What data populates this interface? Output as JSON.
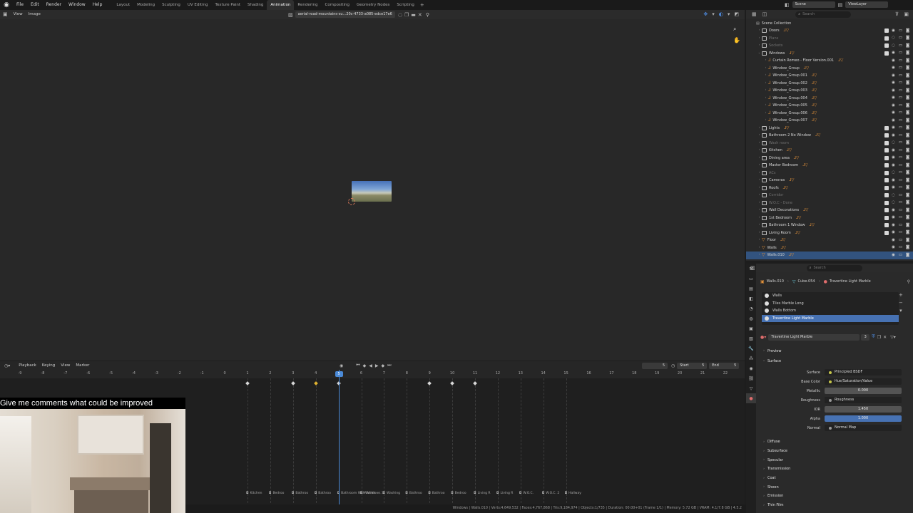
{
  "topbar": {
    "menus": [
      "File",
      "Edit",
      "Render",
      "Window",
      "Help"
    ],
    "workspaces": [
      "Layout",
      "Modeling",
      "Sculpting",
      "UV Editing",
      "Texture Paint",
      "Shading",
      "Animation",
      "Rendering",
      "Compositing",
      "Geometry Nodes",
      "Scripting"
    ],
    "active_workspace": "Animation",
    "scene_label": "Scene",
    "viewlayer_label": "ViewLayer"
  },
  "viewer": {
    "view_label": "View",
    "image_label": "Image",
    "image_name": "aerial-road-mountains-su...20c-4733-a085-edce17e6"
  },
  "outliner": {
    "search_placeholder": "Search",
    "scene_collection": "Scene Collection",
    "rows": [
      {
        "name": "Doors",
        "indent": 1,
        "type": "coll",
        "dim": false,
        "expanded": false
      },
      {
        "name": "Plans",
        "indent": 1,
        "type": "coll",
        "dim": true,
        "expanded": false
      },
      {
        "name": "Sockets",
        "indent": 1,
        "type": "coll",
        "dim": true,
        "expanded": false
      },
      {
        "name": "Windows",
        "indent": 1,
        "type": "coll",
        "dim": false,
        "expanded": true
      },
      {
        "name": "Curtain Romeo - Floor Version.001",
        "indent": 2,
        "type": "obj",
        "dim": false
      },
      {
        "name": "Window_Group",
        "indent": 2,
        "type": "obj",
        "dim": false
      },
      {
        "name": "Window_Group.001",
        "indent": 2,
        "type": "obj",
        "dim": false
      },
      {
        "name": "Window_Group.002",
        "indent": 2,
        "type": "obj",
        "dim": false
      },
      {
        "name": "Window_Group.003",
        "indent": 2,
        "type": "obj",
        "dim": false
      },
      {
        "name": "Window_Group.004",
        "indent": 2,
        "type": "obj",
        "dim": false
      },
      {
        "name": "Window_Group.005",
        "indent": 2,
        "type": "obj",
        "dim": false
      },
      {
        "name": "Window_Group.006",
        "indent": 2,
        "type": "obj",
        "dim": false
      },
      {
        "name": "Window_Group.007",
        "indent": 2,
        "type": "obj",
        "dim": false
      },
      {
        "name": "Lights",
        "indent": 1,
        "type": "coll",
        "dim": false
      },
      {
        "name": "Bathroom 2 No Window",
        "indent": 1,
        "type": "coll",
        "dim": false
      },
      {
        "name": "Wash room",
        "indent": 1,
        "type": "coll",
        "dim": true
      },
      {
        "name": "Kitchen",
        "indent": 1,
        "type": "coll",
        "dim": false
      },
      {
        "name": "Dining area",
        "indent": 1,
        "type": "coll",
        "dim": false
      },
      {
        "name": "Master Bedroom",
        "indent": 1,
        "type": "coll",
        "dim": false
      },
      {
        "name": "ACs",
        "indent": 1,
        "type": "coll",
        "dim": true
      },
      {
        "name": "Cameras",
        "indent": 1,
        "type": "coll",
        "dim": false
      },
      {
        "name": "Roofs",
        "indent": 1,
        "type": "coll",
        "dim": false
      },
      {
        "name": "Corridor",
        "indent": 1,
        "type": "coll",
        "dim": true
      },
      {
        "name": "W.O.C - Done",
        "indent": 1,
        "type": "coll",
        "dim": true
      },
      {
        "name": "Wall Decorations",
        "indent": 1,
        "type": "coll",
        "dim": false
      },
      {
        "name": "1st Bedroom",
        "indent": 1,
        "type": "coll",
        "dim": false
      },
      {
        "name": "Bathroom 1 Window",
        "indent": 1,
        "type": "coll",
        "dim": false
      },
      {
        "name": "Living Room",
        "indent": 1,
        "type": "coll",
        "dim": false
      },
      {
        "name": "Floor",
        "indent": 1,
        "type": "obj",
        "dim": false
      },
      {
        "name": "Walls",
        "indent": 1,
        "type": "obj",
        "dim": false
      },
      {
        "name": "Walls.010",
        "indent": 1,
        "type": "obj",
        "dim": false,
        "selected": true
      }
    ]
  },
  "properties": {
    "search_placeholder": "Search",
    "breadcrumb": [
      "Walls.010",
      "Cube.054",
      "Travertine Light Marble"
    ],
    "material_slots": [
      "Walls",
      "Tiles Marble Long",
      "Walls Bottom",
      "Travertine Light Marble"
    ],
    "material_name": "Travertine Light Marble",
    "users": "3",
    "sections": {
      "preview": "Preview",
      "surface": "Surface"
    },
    "fields": [
      {
        "label": "Surface",
        "value": "Principled BSDF",
        "kind": "dark"
      },
      {
        "label": "Base Color",
        "value": "Hue/Saturation/Value",
        "kind": "dark"
      },
      {
        "label": "Metallic",
        "value": "0.000",
        "kind": "num"
      },
      {
        "label": "Roughness",
        "value": "Roughness",
        "kind": "dark"
      },
      {
        "label": "IOR",
        "value": "1.450",
        "kind": "num"
      },
      {
        "label": "Alpha",
        "value": "1.000",
        "kind": "blue"
      },
      {
        "label": "Normal",
        "value": "Normal Map",
        "kind": "dark"
      }
    ],
    "subsections": [
      "Diffuse",
      "Subsurface",
      "Specular",
      "Transmission",
      "Coat",
      "Sheen",
      "Emission",
      "Thin Film"
    ]
  },
  "timeline": {
    "menus": [
      "Playback",
      "Keying",
      "View",
      "Marker"
    ],
    "current_frame": "5",
    "start_label": "Start",
    "start": "5",
    "end_label": "End",
    "end": "5",
    "ticks": [
      "-9",
      "-8",
      "-7",
      "-6",
      "-5",
      "-4",
      "-3",
      "-2",
      "-1",
      "0",
      "1",
      "2",
      "3",
      "4",
      "5",
      "6",
      "7",
      "8",
      "9",
      "10",
      "11",
      "12",
      "13",
      "14",
      "15",
      "16",
      "17",
      "18",
      "19",
      "20",
      "21",
      "22"
    ],
    "keyframes": [
      1,
      3,
      4,
      5,
      9,
      10,
      11
    ],
    "yellow_keyframe": 4,
    "markers": [
      {
        "frame": 1,
        "label": "Kitchen"
      },
      {
        "frame": 2,
        "label": "Bedroo"
      },
      {
        "frame": 3,
        "label": "Bathroo"
      },
      {
        "frame": 4,
        "label": "Bathroo"
      },
      {
        "frame": 5,
        "label": "Bathroom With Windows 3"
      },
      {
        "frame": 6,
        "label": "Washin"
      },
      {
        "frame": 7,
        "label": "Washing"
      },
      {
        "frame": 8,
        "label": "Bathroo"
      },
      {
        "frame": 9,
        "label": "Bathroo"
      },
      {
        "frame": 10,
        "label": "Bedroo"
      },
      {
        "frame": 11,
        "label": "Living R"
      },
      {
        "frame": 12,
        "label": "Living R"
      },
      {
        "frame": 13,
        "label": "W.O.C."
      },
      {
        "frame": 14,
        "label": "W.O.C. 2"
      },
      {
        "frame": 15,
        "label": "Hallway"
      }
    ]
  },
  "camera_overlay": {
    "comment": "Give me comments what could be improved"
  },
  "statusbar": {
    "text": "Windows | Walls.010 | Verts:4,649,532 | Faces:4,767,868 | Tris:9,184,974 | Objects:1/735 | Duration: 00:00+01 (Frame 1/1) | Memory: 5.72 GB | VRAM: 4.1/7.8 GB | 4.5.2"
  }
}
